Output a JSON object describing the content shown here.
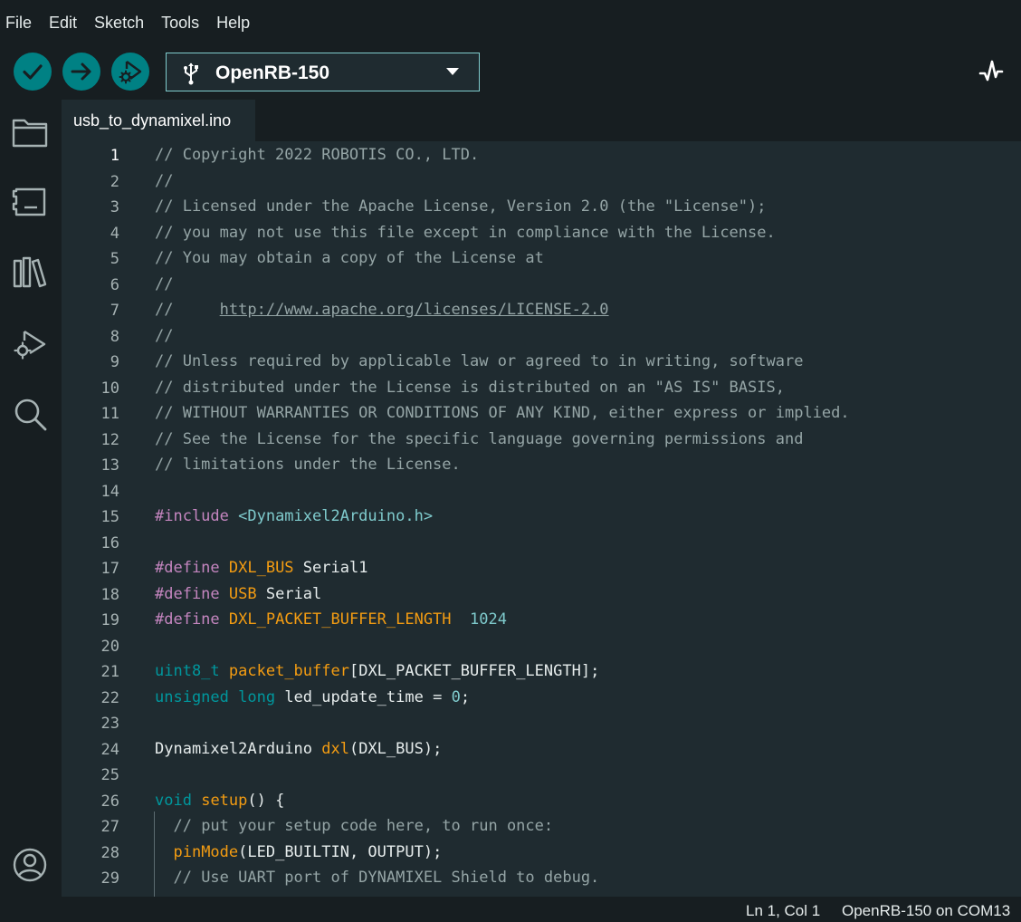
{
  "menu": [
    "File",
    "Edit",
    "Sketch",
    "Tools",
    "Help"
  ],
  "toolbar": {
    "board_name": "OpenRB-150",
    "verify_icon": "checkmark-icon",
    "upload_icon": "arrow-right-icon",
    "debug_icon": "debug-icon",
    "monitor_icon": "serial-plotter-icon"
  },
  "sidebar": {
    "icons": [
      "folder-icon",
      "board-manager-icon",
      "library-icon",
      "debug-icon",
      "search-icon",
      "account-icon"
    ]
  },
  "tabs": [
    {
      "label": "usb_to_dynamixel.ino",
      "active": true
    }
  ],
  "editor": {
    "lines": [
      {
        "n": "1",
        "parts": [
          [
            "c-com",
            "// Copyright 2022 ROBOTIS CO., LTD."
          ]
        ]
      },
      {
        "n": "2",
        "parts": [
          [
            "c-com",
            "//"
          ]
        ]
      },
      {
        "n": "3",
        "parts": [
          [
            "c-com",
            "// Licensed under the Apache License, Version 2.0 (the \"License\");"
          ]
        ]
      },
      {
        "n": "4",
        "parts": [
          [
            "c-com",
            "// you may not use this file except in compliance with the License."
          ]
        ]
      },
      {
        "n": "5",
        "parts": [
          [
            "c-com",
            "// You may obtain a copy of the License at"
          ]
        ]
      },
      {
        "n": "6",
        "parts": [
          [
            "c-com",
            "//"
          ]
        ]
      },
      {
        "n": "7",
        "parts": [
          [
            "c-com",
            "//     "
          ],
          [
            "c-url",
            "http://www.apache.org/licenses/LICENSE-2.0"
          ]
        ]
      },
      {
        "n": "8",
        "parts": [
          [
            "c-com",
            "//"
          ]
        ]
      },
      {
        "n": "9",
        "parts": [
          [
            "c-com",
            "// Unless required by applicable law or agreed to in writing, software"
          ]
        ]
      },
      {
        "n": "10",
        "parts": [
          [
            "c-com",
            "// distributed under the License is distributed on an \"AS IS\" BASIS,"
          ]
        ]
      },
      {
        "n": "11",
        "parts": [
          [
            "c-com",
            "// WITHOUT WARRANTIES OR CONDITIONS OF ANY KIND, either express or implied."
          ]
        ]
      },
      {
        "n": "12",
        "parts": [
          [
            "c-com",
            "// See the License for the specific language governing permissions and"
          ]
        ]
      },
      {
        "n": "13",
        "parts": [
          [
            "c-com",
            "// limitations under the License."
          ]
        ]
      },
      {
        "n": "14",
        "parts": []
      },
      {
        "n": "15",
        "parts": [
          [
            "c-pre",
            "#include "
          ],
          [
            "c-inc",
            "<Dynamixel2Arduino.h>"
          ]
        ]
      },
      {
        "n": "16",
        "parts": []
      },
      {
        "n": "17",
        "parts": [
          [
            "c-pre",
            "#define "
          ],
          [
            "c-mac",
            "DXL_BUS"
          ],
          [
            "c-plain",
            " Serial1"
          ]
        ]
      },
      {
        "n": "18",
        "parts": [
          [
            "c-pre",
            "#define "
          ],
          [
            "c-mac",
            "USB"
          ],
          [
            "c-plain",
            " Serial"
          ]
        ]
      },
      {
        "n": "19",
        "parts": [
          [
            "c-pre",
            "#define "
          ],
          [
            "c-mac",
            "DXL_PACKET_BUFFER_LENGTH"
          ],
          [
            "c-plain",
            "  "
          ],
          [
            "c-num",
            "1024"
          ]
        ]
      },
      {
        "n": "20",
        "parts": []
      },
      {
        "n": "21",
        "parts": [
          [
            "c-type",
            "uint8_t"
          ],
          [
            "c-plain",
            " "
          ],
          [
            "c-fn",
            "packet_buffer"
          ],
          [
            "c-plain",
            "[DXL_PACKET_BUFFER_LENGTH];"
          ]
        ]
      },
      {
        "n": "22",
        "parts": [
          [
            "c-type",
            "unsigned"
          ],
          [
            "c-plain",
            " "
          ],
          [
            "c-type",
            "long"
          ],
          [
            "c-plain",
            " led_update_time = "
          ],
          [
            "c-num",
            "0"
          ],
          [
            "c-plain",
            ";"
          ]
        ]
      },
      {
        "n": "23",
        "parts": []
      },
      {
        "n": "24",
        "parts": [
          [
            "c-plain",
            "Dynamixel2Arduino "
          ],
          [
            "c-fn",
            "dxl"
          ],
          [
            "c-plain",
            "(DXL_BUS);"
          ]
        ]
      },
      {
        "n": "25",
        "parts": []
      },
      {
        "n": "26",
        "parts": [
          [
            "c-type",
            "void"
          ],
          [
            "c-plain",
            " "
          ],
          [
            "c-fn",
            "setup"
          ],
          [
            "c-plain",
            "() {"
          ]
        ]
      },
      {
        "n": "27",
        "parts": [
          [
            "c-plain",
            "  "
          ],
          [
            "c-com",
            "// put your setup code here, to run once:"
          ]
        ]
      },
      {
        "n": "28",
        "parts": [
          [
            "c-plain",
            "  "
          ],
          [
            "c-fn",
            "pinMode"
          ],
          [
            "c-plain",
            "(LED_BUILTIN, OUTPUT);"
          ]
        ]
      },
      {
        "n": "29",
        "parts": [
          [
            "c-plain",
            "  "
          ],
          [
            "c-com",
            "// Use UART port of DYNAMIXEL Shield to debug."
          ]
        ]
      }
    ]
  },
  "status": {
    "cursor": "Ln 1, Col 1",
    "port": "OpenRB-150 on COM13"
  }
}
